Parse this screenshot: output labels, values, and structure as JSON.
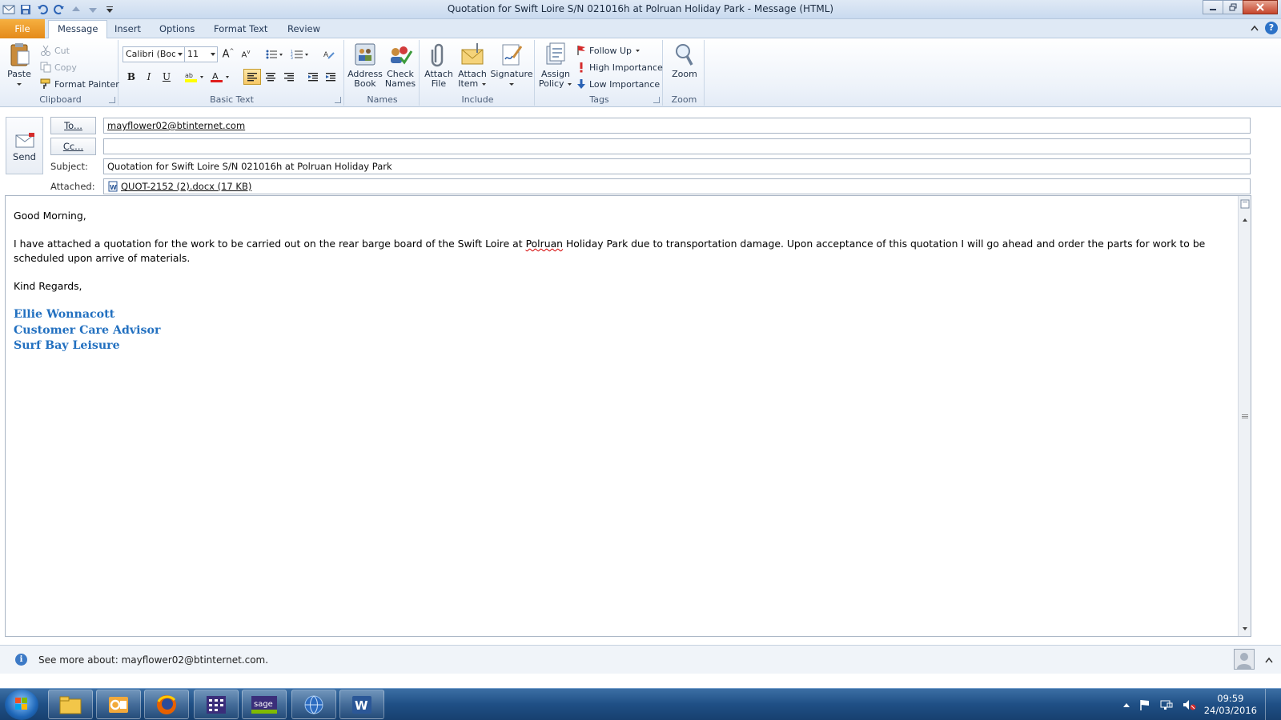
{
  "window": {
    "title": "Quotation for Swift Loire S/N 021016h at Polruan Holiday Park  -  Message (HTML)"
  },
  "tabs": [
    "File",
    "Message",
    "Insert",
    "Options",
    "Format Text",
    "Review"
  ],
  "active_tab": "Message",
  "ribbon": {
    "clipboard": {
      "paste": "Paste",
      "cut": "Cut",
      "copy": "Copy",
      "format_painter": "Format Painter",
      "label": "Clipboard"
    },
    "basic_text": {
      "font_name": "Calibri (Body)",
      "font_size": "11",
      "label": "Basic Text",
      "bold": "B",
      "italic": "I",
      "underline": "U"
    },
    "names": {
      "address_book": [
        "Address",
        "Book"
      ],
      "check_names": [
        "Check",
        "Names"
      ],
      "label": "Names"
    },
    "include": {
      "attach_file": [
        "Attach",
        "File"
      ],
      "attach_item": [
        "Attach",
        "Item"
      ],
      "signature": "Signature",
      "label": "Include"
    },
    "tags": {
      "assign_policy": [
        "Assign",
        "Policy"
      ],
      "follow_up": "Follow Up",
      "high_importance": "High Importance",
      "low_importance": "Low Importance",
      "label": "Tags"
    },
    "zoom": {
      "zoom": "Zoom",
      "label": "Zoom"
    }
  },
  "compose": {
    "send_label": "Send",
    "to_button": "To...",
    "cc_button": "Cc...",
    "to_value": "mayflower02@btinternet.com",
    "cc_value": "",
    "subject_label": "Subject:",
    "subject_value": "Quotation for Swift Loire S/N 021016h at Polruan Holiday Park",
    "attached_label": "Attached:",
    "attachment": "QUOT-2152 (2).docx (17 KB)"
  },
  "body": {
    "greeting": "Good Morning,",
    "para_before": "I have attached a quotation for the work to be carried out on the rear barge board of the Swift Loire at ",
    "para_misspelled": "Polruan",
    "para_after": " Holiday Park due to transportation damage. Upon acceptance of this quotation I will go ahead and order the parts for work to be scheduled upon arrive of materials.",
    "closing": "Kind Regards,",
    "signature": [
      "Ellie Wonnacott",
      "Customer Care Advisor",
      "Surf Bay Leisure"
    ]
  },
  "people_pane": {
    "see_more": "See more about: mayflower02@btinternet.com."
  },
  "taskbar": {
    "apps": [
      "explorer",
      "outlook",
      "firefox",
      "calendar-app",
      "sage",
      "network-app",
      "word"
    ],
    "time": "09:59",
    "date": "24/03/2016"
  },
  "colors": {
    "file_tab": "#e48a1a",
    "signature": "#2270c0",
    "accent": "#2c72c7"
  }
}
